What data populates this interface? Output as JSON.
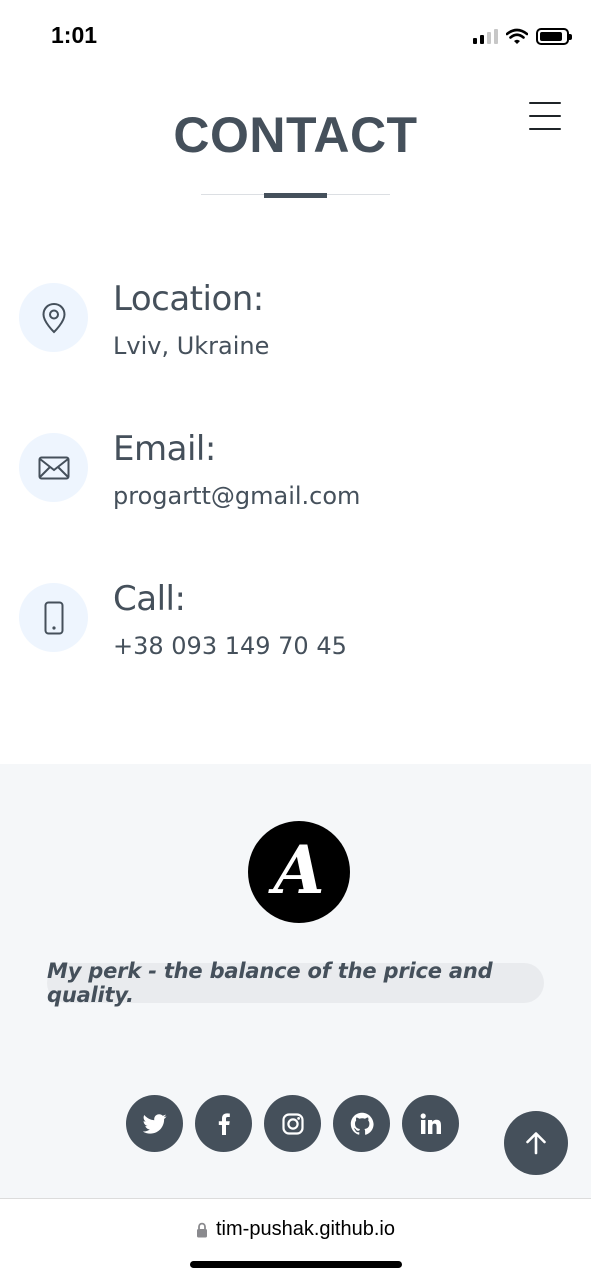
{
  "status_bar": {
    "time": "1:01"
  },
  "header": {
    "title": "CONTACT"
  },
  "contact": {
    "items": [
      {
        "label": "Location:",
        "value": "Lviv, Ukraine",
        "icon": "map-pin-icon"
      },
      {
        "label": "Email:",
        "value": "progartt@gmail.com",
        "icon": "envelope-icon"
      },
      {
        "label": "Call:",
        "value": "+38 093 149 70 45",
        "icon": "phone-icon"
      }
    ]
  },
  "footer": {
    "logo_letter": "A",
    "tagline": "My perk - the balance of the price and quality.",
    "social": [
      "twitter-icon",
      "facebook-icon",
      "instagram-icon",
      "github-icon",
      "linkedin-icon"
    ]
  },
  "browser": {
    "url": "tim-pushak.github.io"
  },
  "colors": {
    "primary": "#45505b",
    "icon_bg": "#eef5fe",
    "footer_bg": "#f5f7f9",
    "tagline_bg": "#e9ebee"
  }
}
